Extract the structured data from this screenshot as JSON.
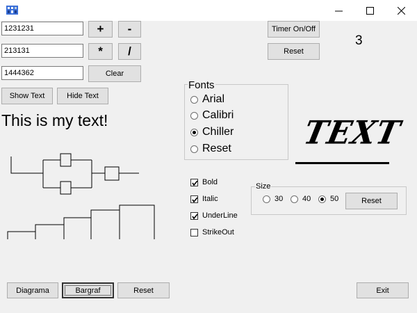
{
  "window": {
    "minimize_glyph": "—",
    "maximize_glyph": "☐",
    "close_glyph": "✕"
  },
  "calc": {
    "field1": "1231231",
    "field2": "213131",
    "field3": "1444362",
    "plus": "+",
    "minus": "-",
    "multiply": "*",
    "divide": "/",
    "clear": "Clear"
  },
  "timer": {
    "toggle_label": "Timer On/Off",
    "reset_label": "Reset",
    "count": "3"
  },
  "text_controls": {
    "show": "Show Text",
    "hide": "Hide Text",
    "sample": "This is my text!"
  },
  "fonts": {
    "legend": "Fonts",
    "options": [
      "Arial",
      "Calibri",
      "Chiller",
      "Reset"
    ],
    "selected": "Chiller"
  },
  "preview_text": "TEXT",
  "styles": {
    "bold": "Bold",
    "bold_checked": true,
    "italic": "Italic",
    "italic_checked": true,
    "underline": "UnderLine",
    "underline_checked": true,
    "strikeout": "StrikeOut",
    "strikeout_checked": false
  },
  "size": {
    "legend": "Size",
    "options": [
      "30",
      "40",
      "50"
    ],
    "selected": "50",
    "reset": "Reset"
  },
  "bottom": {
    "diagrama": "Diagrama",
    "bargraf": "Bargraf",
    "reset": "Reset",
    "exit": "Exit"
  },
  "colors": {
    "title_bg": "#ffffff",
    "window_bg": "#f0f0f0",
    "button_bg": "#e1e1e1"
  }
}
